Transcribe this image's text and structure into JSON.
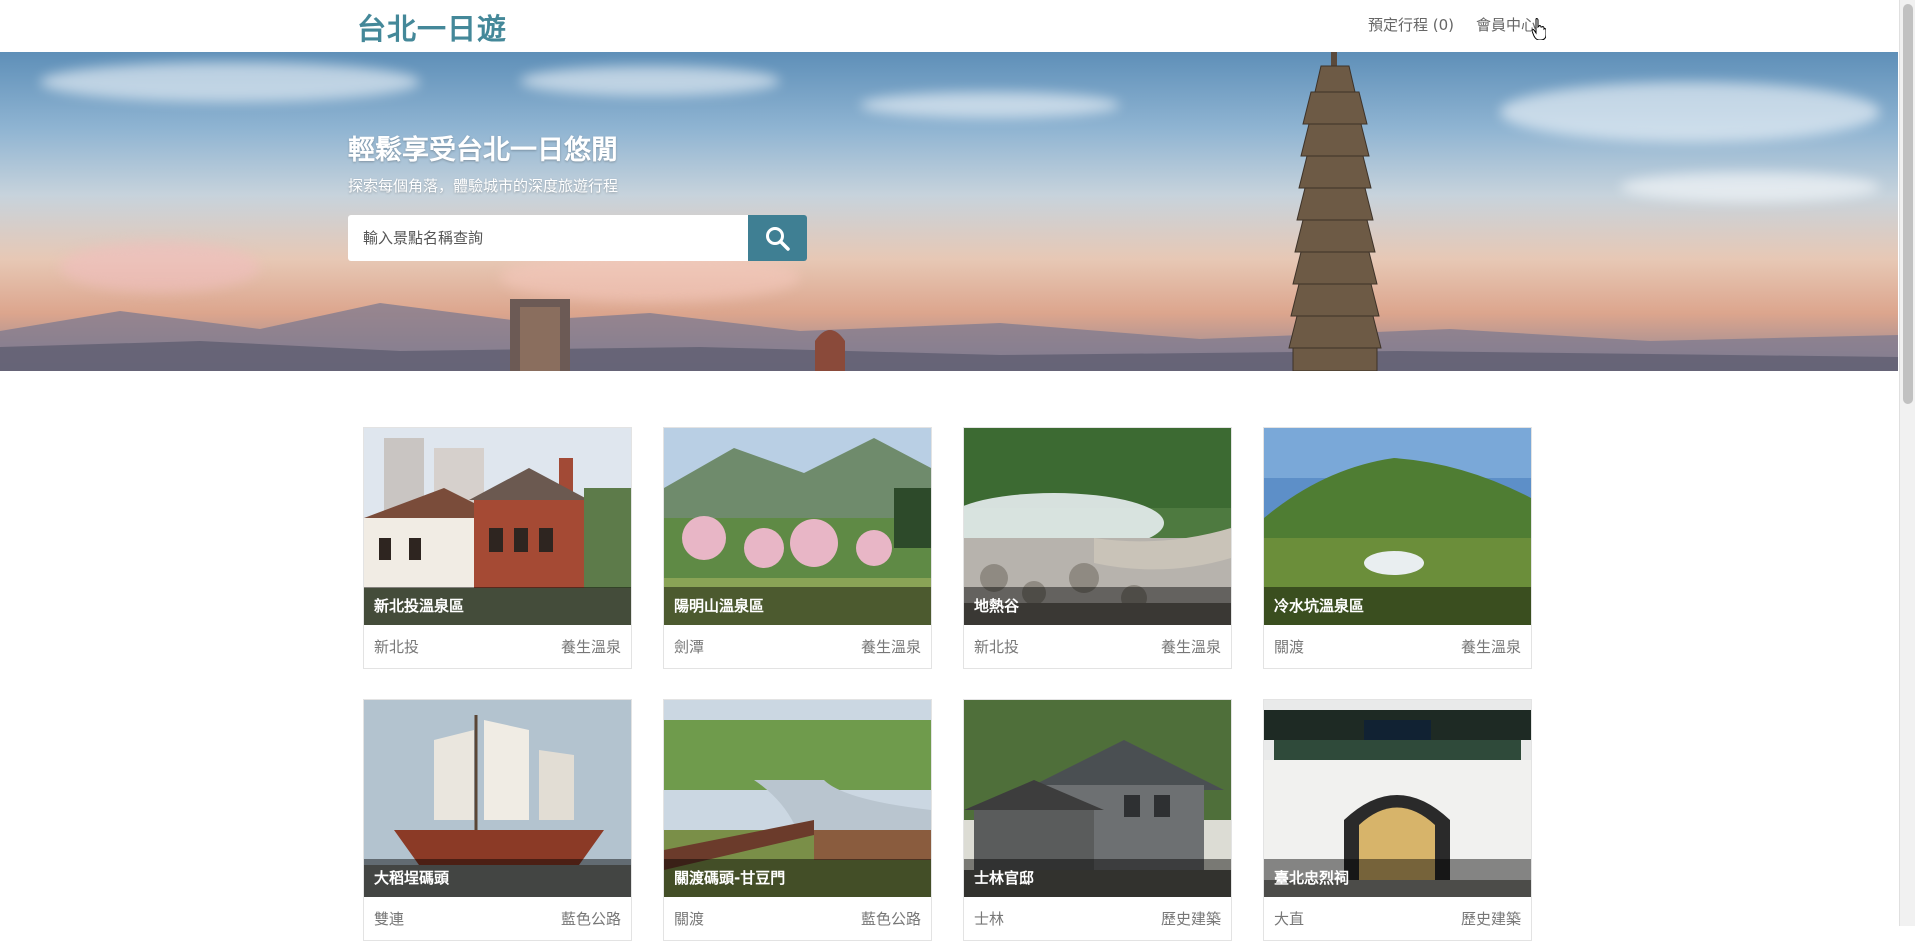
{
  "navbar": {
    "brand": "台北一日遊",
    "booking_label": "預定行程 (0)",
    "member_label": "會員中心"
  },
  "hero": {
    "title": "輕鬆享受台北一日悠閒",
    "subtitle": "探索每個角落，體驗城市的深度旅遊行程",
    "search_placeholder": "輸入景點名稱查詢",
    "search_icon": "search-icon",
    "search_button_color": "#3f7f93"
  },
  "colors": {
    "brand": "#448899",
    "accent": "#3f7f93"
  },
  "attractions": [
    {
      "name": "新北投溫泉區",
      "area": "新北投",
      "category": "養生溫泉",
      "scene": "brick-building"
    },
    {
      "name": "陽明山溫泉區",
      "area": "劍潭",
      "category": "養生溫泉",
      "scene": "mountain-garden"
    },
    {
      "name": "地熱谷",
      "area": "新北投",
      "category": "養生溫泉",
      "scene": "steam-valley"
    },
    {
      "name": "冷水坑溫泉區",
      "area": "關渡",
      "category": "養生溫泉",
      "scene": "green-hill"
    },
    {
      "name": "大稻埕碼頭",
      "area": "雙連",
      "category": "藍色公路",
      "scene": "sailing-ship"
    },
    {
      "name": "關渡碼頭-甘豆門",
      "area": "關渡",
      "category": "藍色公路",
      "scene": "wetland-bridge"
    },
    {
      "name": "士林官邸",
      "area": "士林",
      "category": "歷史建築",
      "scene": "old-residence"
    },
    {
      "name": "臺北忠烈祠",
      "area": "大直",
      "category": "歷史建築",
      "scene": "shrine-gate"
    }
  ]
}
